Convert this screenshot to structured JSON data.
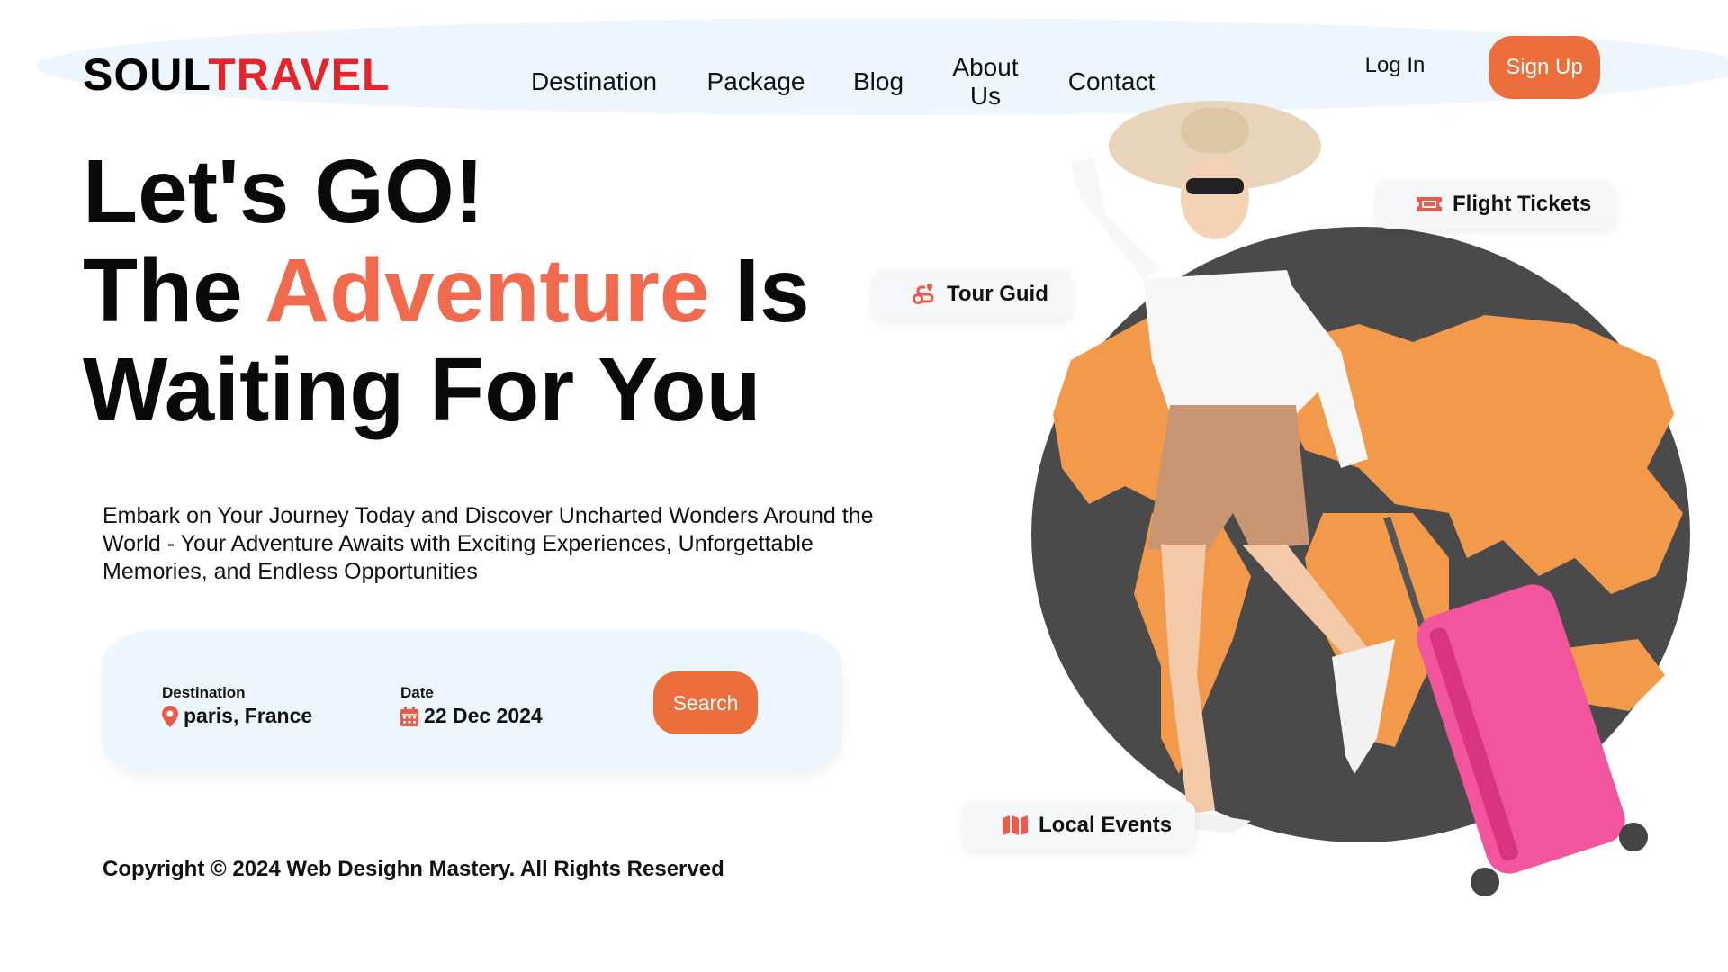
{
  "brand": {
    "part1": "SOUL",
    "part2": "TRAVEL",
    "color_part2": "#e8232a"
  },
  "nav": {
    "items": [
      {
        "label": "Destination"
      },
      {
        "label": "Package"
      },
      {
        "label": "Blog"
      },
      {
        "label": "About\nUs"
      },
      {
        "label": "Contact"
      }
    ],
    "login_label": "Log In",
    "signup_label": "Sign Up"
  },
  "hero": {
    "line1": "Let's GO!",
    "line2_prefix": "The ",
    "line2_accent": "Adventure",
    "line2_suffix": " Is",
    "line3": "Waiting For You",
    "accent_color": "#f26a4d",
    "subtitle": "Embark on Your Journey Today and Discover Uncharted Wonders Around the World - Your Adventure Awaits with Exciting Experiences, Unforgettable Memories, and Endless Opportunities"
  },
  "search": {
    "destination_label": "Destination",
    "destination_value": "paris, France",
    "destination_icon": "map-pin-icon",
    "date_label": "Date",
    "date_value": "22 Dec 2024",
    "date_icon": "calendar-icon",
    "button_label": "Search"
  },
  "chips": {
    "flight": {
      "label": "Flight Tickets",
      "icon": "ticket-icon"
    },
    "tour": {
      "label": "Tour Guid",
      "icon": "route-icon"
    },
    "events": {
      "label": "Local Events",
      "icon": "map-icon"
    }
  },
  "footer": {
    "copyright": "Copyright © 2024 Web Desighn Mastery. All Rights Reserved"
  },
  "colors": {
    "button": "#ec6e3c",
    "navbar_bg": "#eef6fd",
    "globe_dark": "#4a4a4a",
    "continents": "#f39a4a",
    "suitcase": "#f2549e"
  }
}
